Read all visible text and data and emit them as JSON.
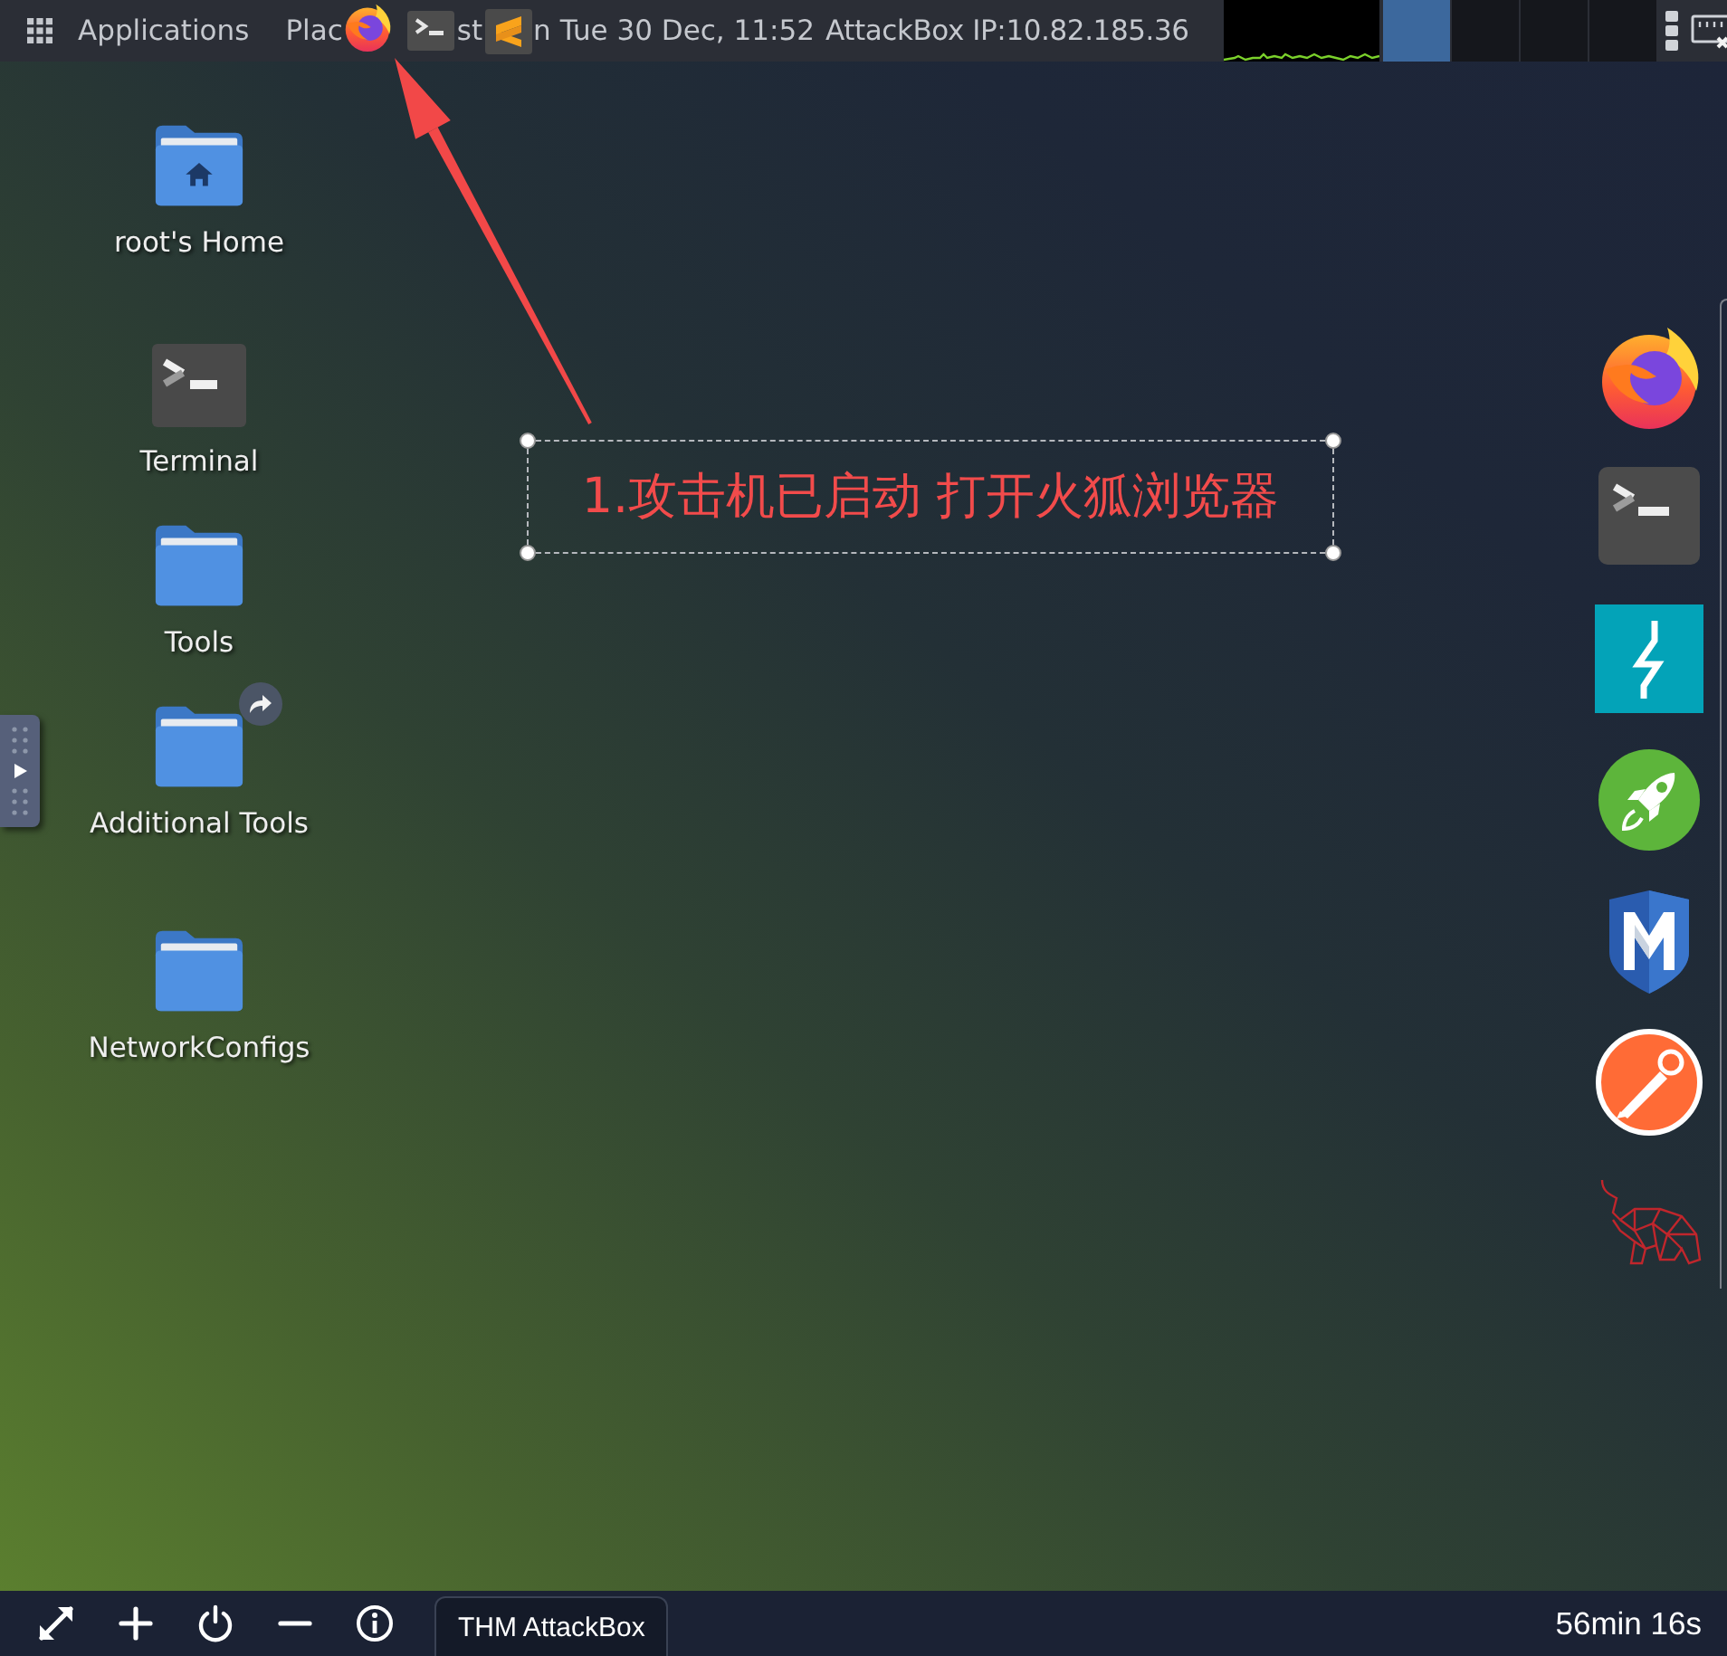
{
  "top_panel": {
    "applications_menu": "Applications",
    "places_menu": "Plac",
    "system_menu_fragments": [
      "st",
      "n"
    ],
    "clock": "Tue 30 Dec, 11:52",
    "ip_label": "AttackBox IP:10.82.185.36",
    "workspaces": [
      {
        "selected": true
      },
      {
        "selected": false
      },
      {
        "selected": false
      },
      {
        "selected": false
      }
    ]
  },
  "desktop_icons": [
    {
      "label": "root's Home",
      "kind": "home"
    },
    {
      "label": "Terminal",
      "kind": "app"
    },
    {
      "label": "Tools",
      "kind": "folder"
    },
    {
      "label": "Additional Tools",
      "kind": "link"
    },
    {
      "label": "NetworkConfigs",
      "kind": "folder"
    }
  ],
  "annotation": {
    "text": "1.攻击机已启动 打开火狐浏览器"
  },
  "bottom_panel": {
    "task_button": "THM AttackBox",
    "timer": "56min 16s"
  }
}
